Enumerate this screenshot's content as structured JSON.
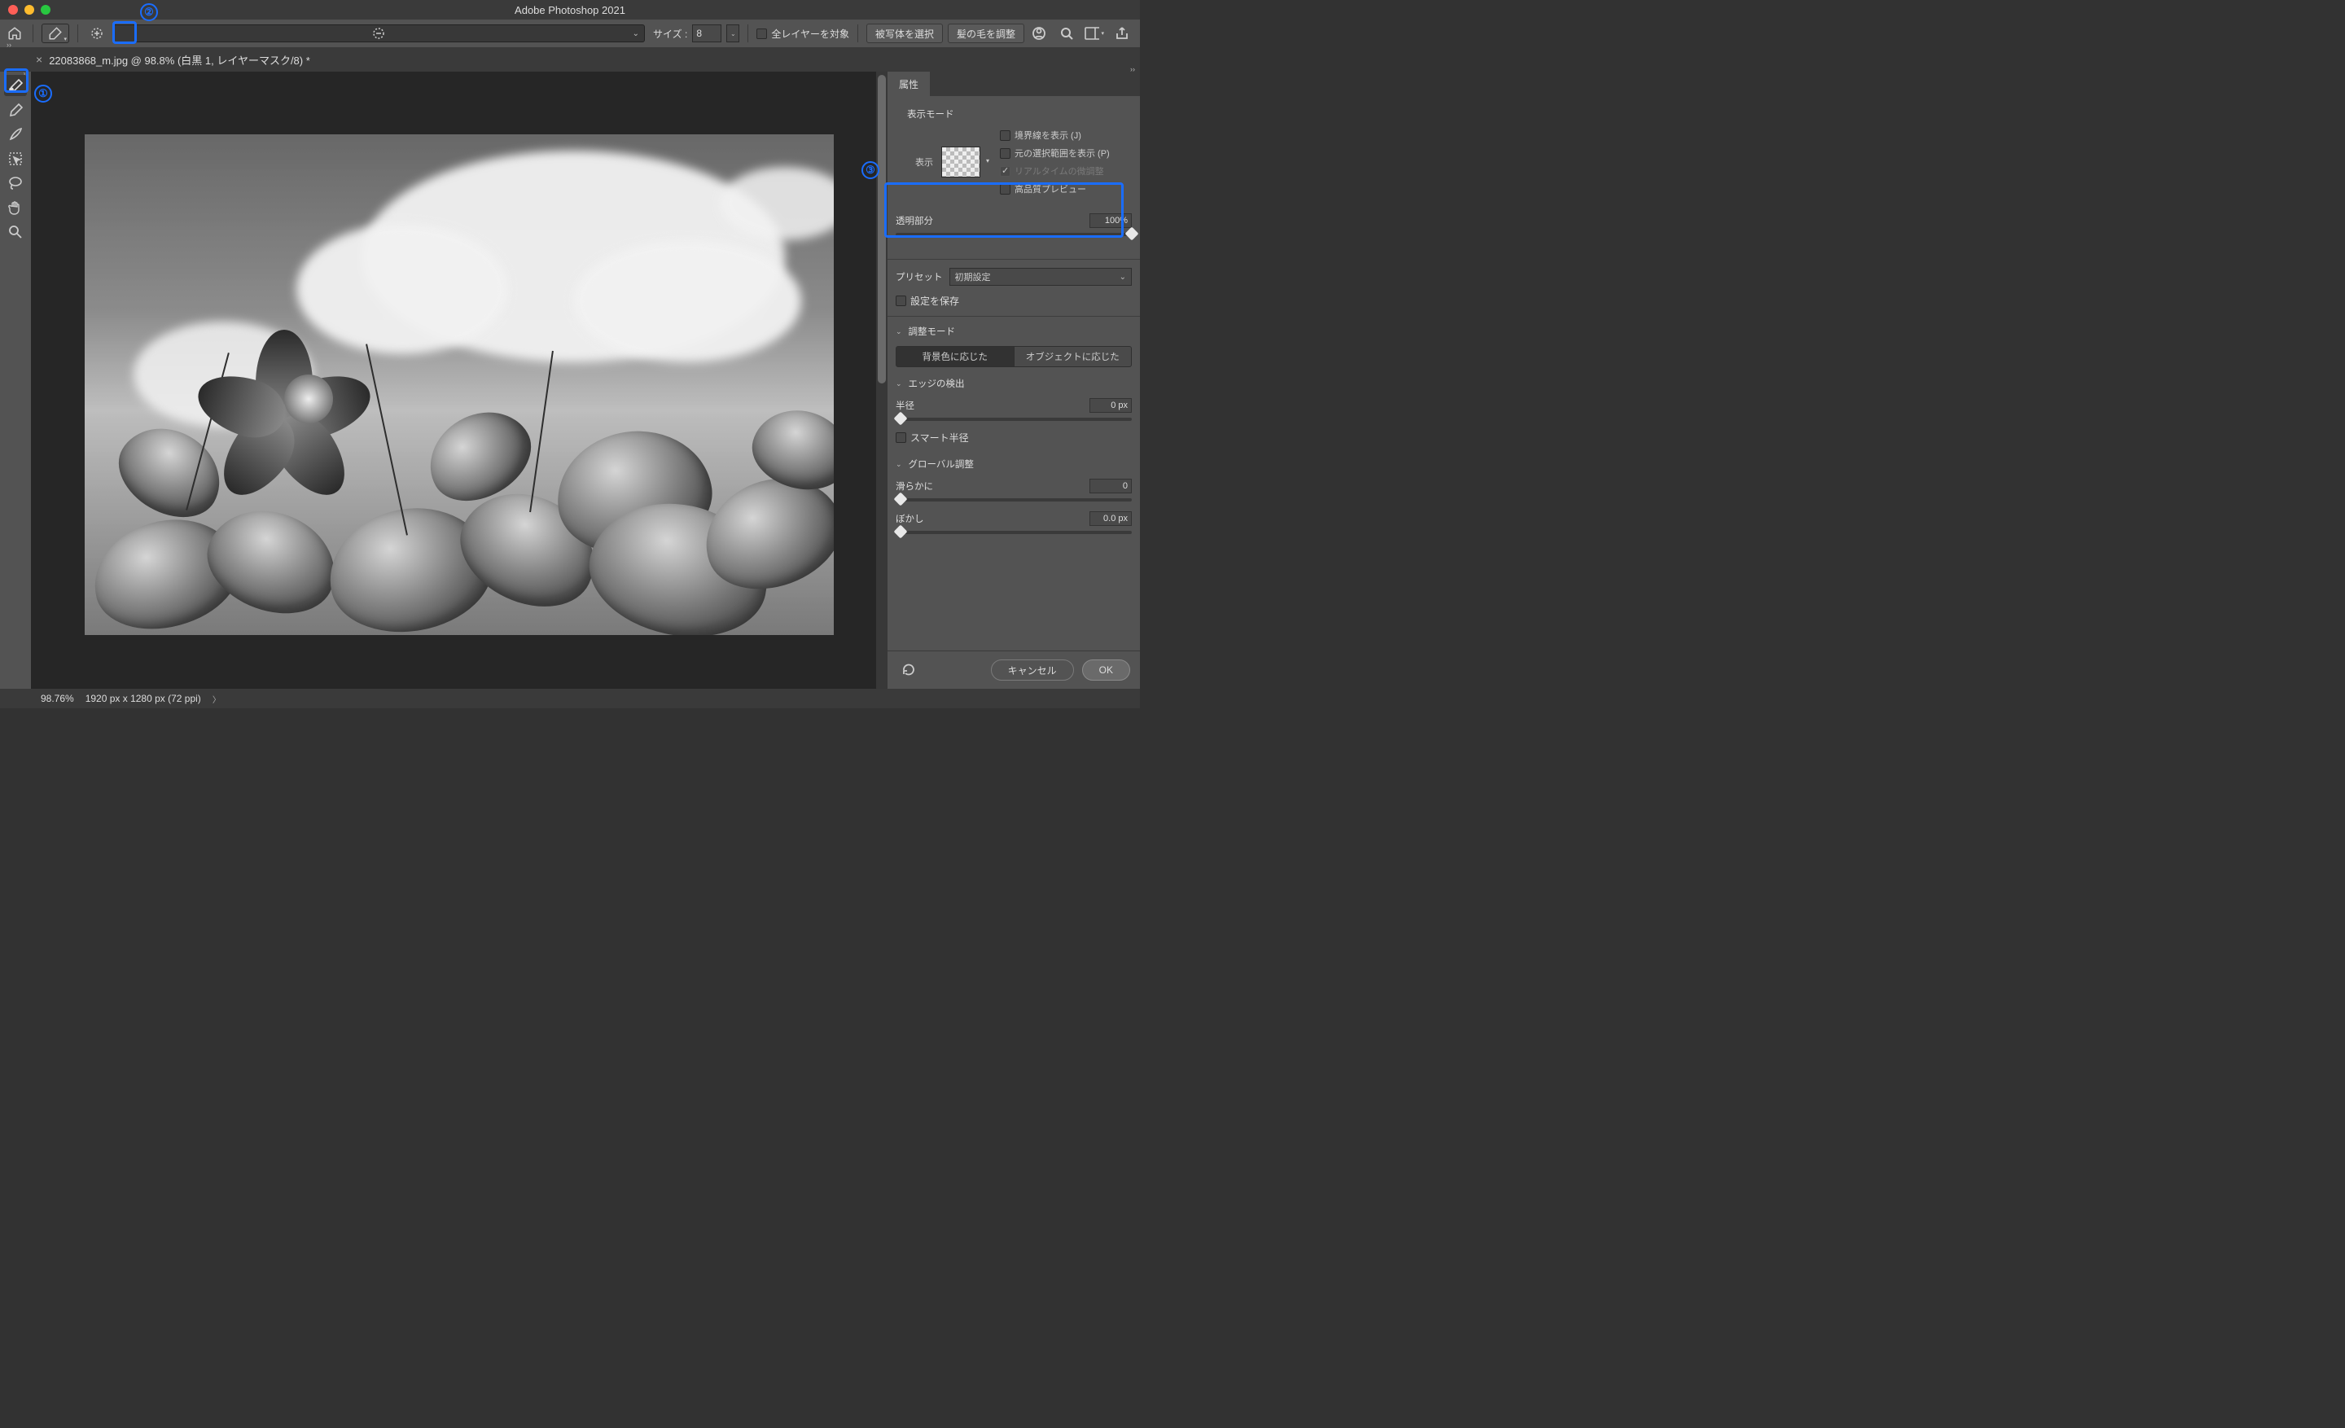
{
  "app_title": "Adobe Photoshop 2021",
  "options_bar": {
    "size_label": "サイズ :",
    "size_value": "8",
    "all_layers": "全レイヤーを対象",
    "select_subject": "被写体を選択",
    "refine_hair": "髪の毛を調整"
  },
  "document_tab": "22083868_m.jpg @ 98.8% (白黒 1, レイヤーマスク/8) *",
  "panel": {
    "tab": "属性",
    "view_mode_title": "表示モード",
    "view_label": "表示",
    "show_edge": "境界線を表示 (J)",
    "show_original": "元の選択範囲を表示 (P)",
    "realtime": "リアルタイムの微調整",
    "hq_preview": "高品質プレビュー",
    "transparency_label": "透明部分",
    "transparency_value": "100%",
    "preset_label": "プリセット",
    "preset_value": "初期設定",
    "remember_settings": "設定を保存",
    "adjust_mode": "調整モード",
    "color_aware": "背景色に応じた",
    "object_aware": "オブジェクトに応じた",
    "edge_detection": "エッジの検出",
    "radius_label": "半径",
    "radius_value": "0 px",
    "smart_radius": "スマート半径",
    "global_refine": "グローバル調整",
    "smooth_label": "滑らかに",
    "smooth_value": "0",
    "feather_label": "ぼかし",
    "feather_value": "0.0 px",
    "cancel": "キャンセル",
    "ok": "OK"
  },
  "status": {
    "zoom": "98.76%",
    "doc": "1920 px x 1280 px (72 ppi)"
  }
}
